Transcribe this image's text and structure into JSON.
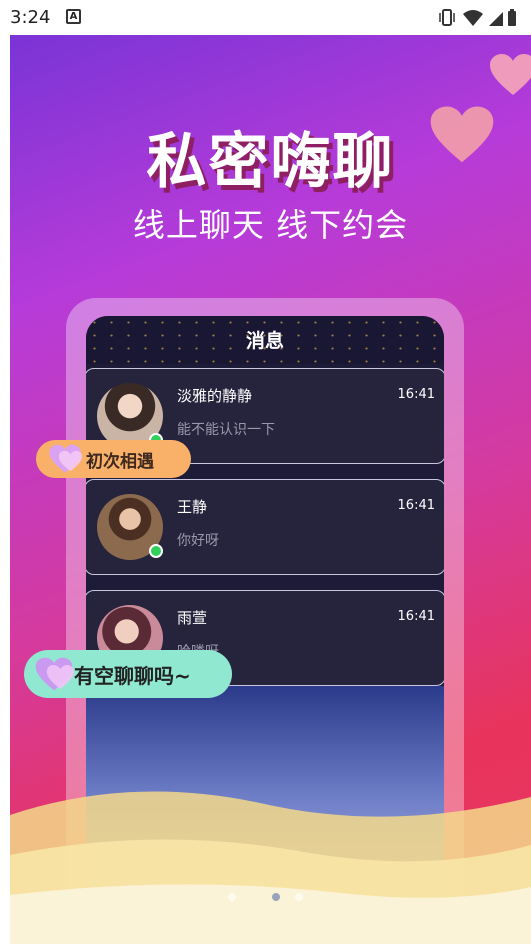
{
  "status_bar": {
    "time": "3:24",
    "notification_icon": "A"
  },
  "banner": {
    "title": "私密嗨聊",
    "subtitle": "线上聊天 线下约会"
  },
  "phone_screen": {
    "title": "消息",
    "conversations": [
      {
        "name": "淡雅的静静",
        "time": "16:41",
        "preview": "能不能认识一下"
      },
      {
        "name": "王静",
        "time": "16:41",
        "preview": "你好呀"
      },
      {
        "name": "雨萱",
        "time": "16:41",
        "preview": "哈喽呀"
      }
    ]
  },
  "bubbles": {
    "first_meet": "初次相遇",
    "chat_invite": "有空聊聊吗~"
  },
  "pager": {
    "pages": 3,
    "active": 2
  },
  "colors": {
    "accent_pink": "#e8345b",
    "accent_purple": "#7a34d6",
    "bubble_orange": "#f9b169",
    "bubble_mint": "#8fe8cf",
    "online": "#2fd15a"
  }
}
